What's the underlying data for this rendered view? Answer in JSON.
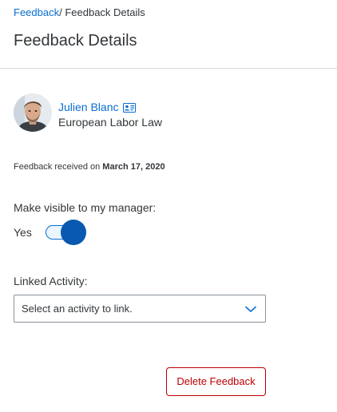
{
  "breadcrumb": {
    "parent_label": "Feedback",
    "separator": "/ ",
    "current_label": "Feedback Details"
  },
  "page": {
    "title": "Feedback Details"
  },
  "author": {
    "name": "Julien Blanc",
    "subtitle": "European Labor Law",
    "avatar_icon": "person-photo-icon",
    "card_icon": "contact-card-icon"
  },
  "received": {
    "prefix": "Feedback received on",
    "date": "March 17, 2020"
  },
  "manager_visibility": {
    "label": "Make visible to my manager:",
    "state_text": "Yes",
    "on": true
  },
  "linked_activity": {
    "label": "Linked Activity:",
    "placeholder": "Select an activity to link.",
    "arrow_icon": "chevron-down-icon"
  },
  "actions": {
    "delete_label": "Delete Feedback"
  },
  "colors": {
    "link": "#0a6ed1",
    "text": "#32363a",
    "toggle_handle": "#0a59b0",
    "danger": "#bb0000",
    "divider": "#d9d9d9"
  }
}
